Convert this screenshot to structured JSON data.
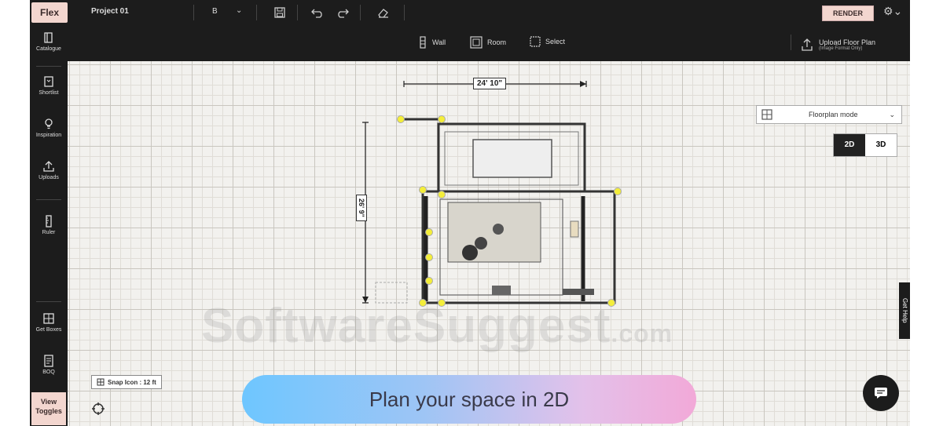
{
  "topbar": {
    "logo": "Flex",
    "project_name": "Project 01",
    "floor_value": "B",
    "render_label": "RENDER"
  },
  "toolbar": {
    "wall": "Wall",
    "room": "Room",
    "select": "Select",
    "upload_title": "Upload Floor Plan",
    "upload_sub": "(Image Format Only)"
  },
  "sidebar": {
    "items": [
      {
        "label": "Catalogue",
        "icon": "book-icon"
      },
      {
        "label": "Shortlist",
        "icon": "bookmark-icon"
      },
      {
        "label": "Inspiration",
        "icon": "bulb-icon"
      },
      {
        "label": "Uploads",
        "icon": "upload-icon"
      },
      {
        "label": "Ruler",
        "icon": "ruler-icon"
      },
      {
        "label": "Get Boxes",
        "icon": "boxes-icon"
      },
      {
        "label": "BOQ",
        "icon": "list-icon"
      }
    ],
    "view_toggle": "View Toggles"
  },
  "canvas": {
    "width_dim": "24' 10\"",
    "height_dim": "26' 9\"",
    "view_2d": "2D",
    "view_3d": "3D",
    "dropdown_value": "Floorplan mode",
    "get_help": "Get Help",
    "snap_label": "Snap Icon : 12 ft",
    "banner": "Plan your space in 2D",
    "watermark": "SoftwareSuggest",
    "watermark_tld": ".com"
  },
  "colors": {
    "dark": "#1c1c1c",
    "accent_pink": "#f3d6cf",
    "canvas": "#f2f1ee",
    "handle": "#f4ee3a"
  }
}
